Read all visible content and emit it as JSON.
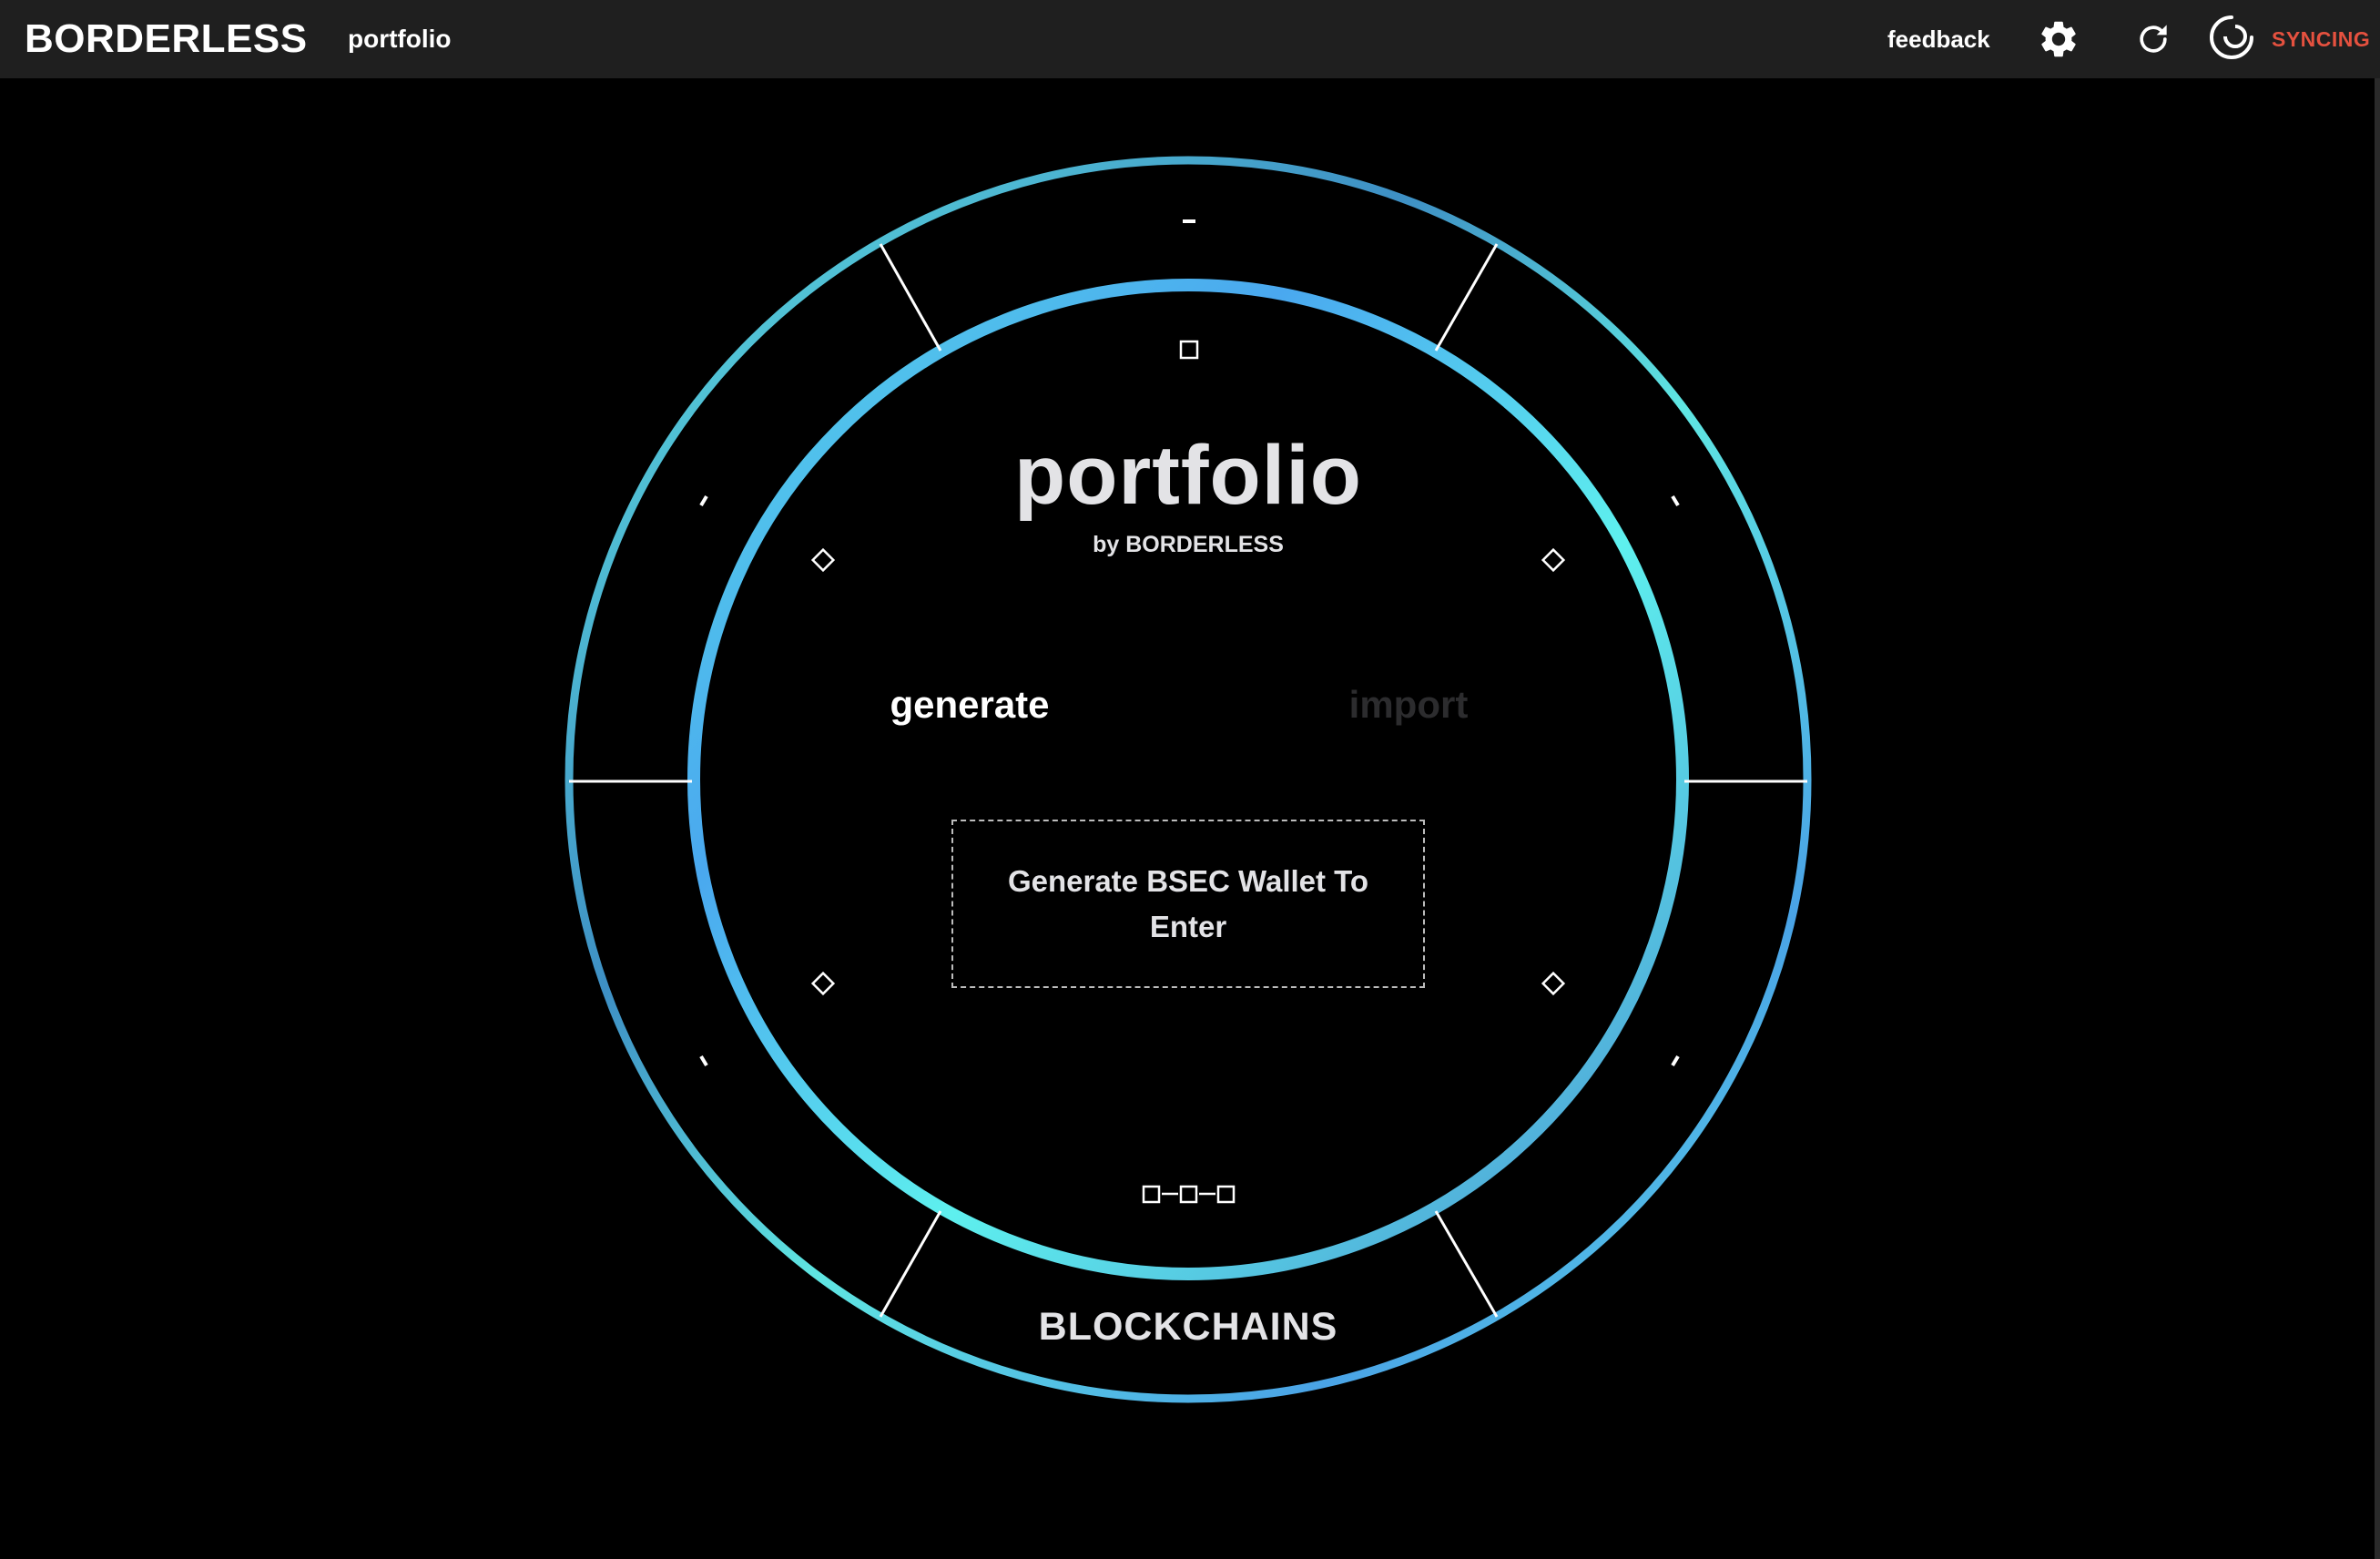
{
  "header": {
    "brand": "BORDERLESS",
    "app_name": "portfolio",
    "feedback_label": "feedback",
    "sync_status": "SYNCING",
    "icons": [
      "gear-icon",
      "refresh-icon",
      "sync-status-icon"
    ]
  },
  "dial": {
    "title": "portfolio",
    "subtitle": "by BORDERLESS",
    "tabs": [
      {
        "label": "generate",
        "active": true
      },
      {
        "label": "import",
        "active": false
      }
    ],
    "action_text": "Generate BSEC Wallet To Enter",
    "outer_label": "BLOCKCHAINS",
    "outer_top_marker": "-",
    "icons": [
      "square-icon",
      "diamond-icon",
      "chain-link-icon"
    ]
  },
  "colors": {
    "topbar_bg": "#1f1f1f",
    "page_bg": "#000000",
    "ring_cyan": "#5ee8e8",
    "ring_blue": "#4aa3e6",
    "sync_red": "#e5513f",
    "inactive_tab": "#2c2c2e"
  }
}
